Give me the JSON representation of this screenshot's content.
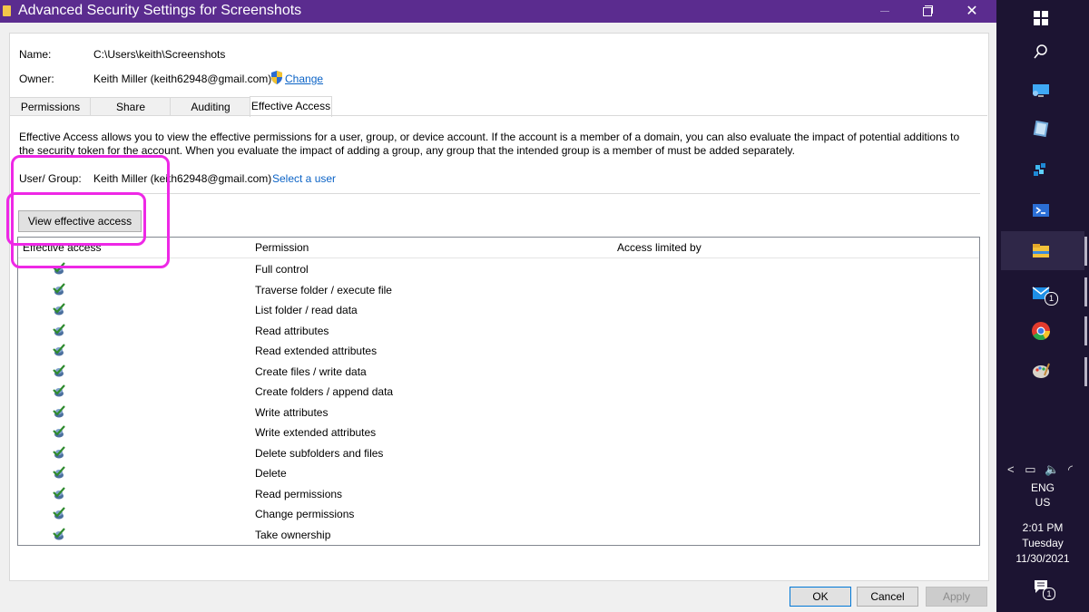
{
  "window": {
    "title": "Advanced Security Settings for Screenshots",
    "close_glyph": "✕"
  },
  "info": {
    "name_label": "Name:",
    "name_value": "C:\\Users\\keith\\Screenshots",
    "owner_label": "Owner:",
    "owner_value": "Keith Miller (keith62948@gmail.com)",
    "change_link": "Change"
  },
  "tabs": [
    {
      "label": "Permissions"
    },
    {
      "label": "Share"
    },
    {
      "label": "Auditing"
    },
    {
      "label": "Effective Access",
      "active": true
    }
  ],
  "description": "Effective Access allows you to view the effective permissions for a user, group, or device account. If the account is a member of a domain, you can also evaluate the impact of potential additions to the security token for the account. When you evaluate the impact of adding a group, any group that the intended group is a member of must be added separately.",
  "user_group": {
    "label": "User/ Group:",
    "value": "Keith Miller (keith62948@gmail.com)",
    "select_link": "Select a user"
  },
  "view_button": "View effective access",
  "list": {
    "columns": [
      "Effective access",
      "Permission",
      "Access limited by"
    ],
    "rows": [
      "Full control",
      "Traverse folder / execute file",
      "List folder / read data",
      "Read attributes",
      "Read extended attributes",
      "Create files / write data",
      "Create folders / append data",
      "Write attributes",
      "Write extended attributes",
      "Delete subfolders and files",
      "Delete",
      "Read permissions",
      "Change permissions",
      "Take ownership"
    ]
  },
  "footer": {
    "ok": "OK",
    "cancel": "Cancel",
    "apply": "Apply"
  },
  "taskbar": {
    "language": "ENG",
    "region": "US",
    "time": "2:01 PM",
    "day": "Tuesday",
    "date": "11/30/2021",
    "mail_badge": "1",
    "notification_badge": "1"
  },
  "colors": {
    "titlebar": "#5b2c8f",
    "taskbar": "#1c1432",
    "highlight": "#ee28e6",
    "link": "#0b63c6"
  }
}
